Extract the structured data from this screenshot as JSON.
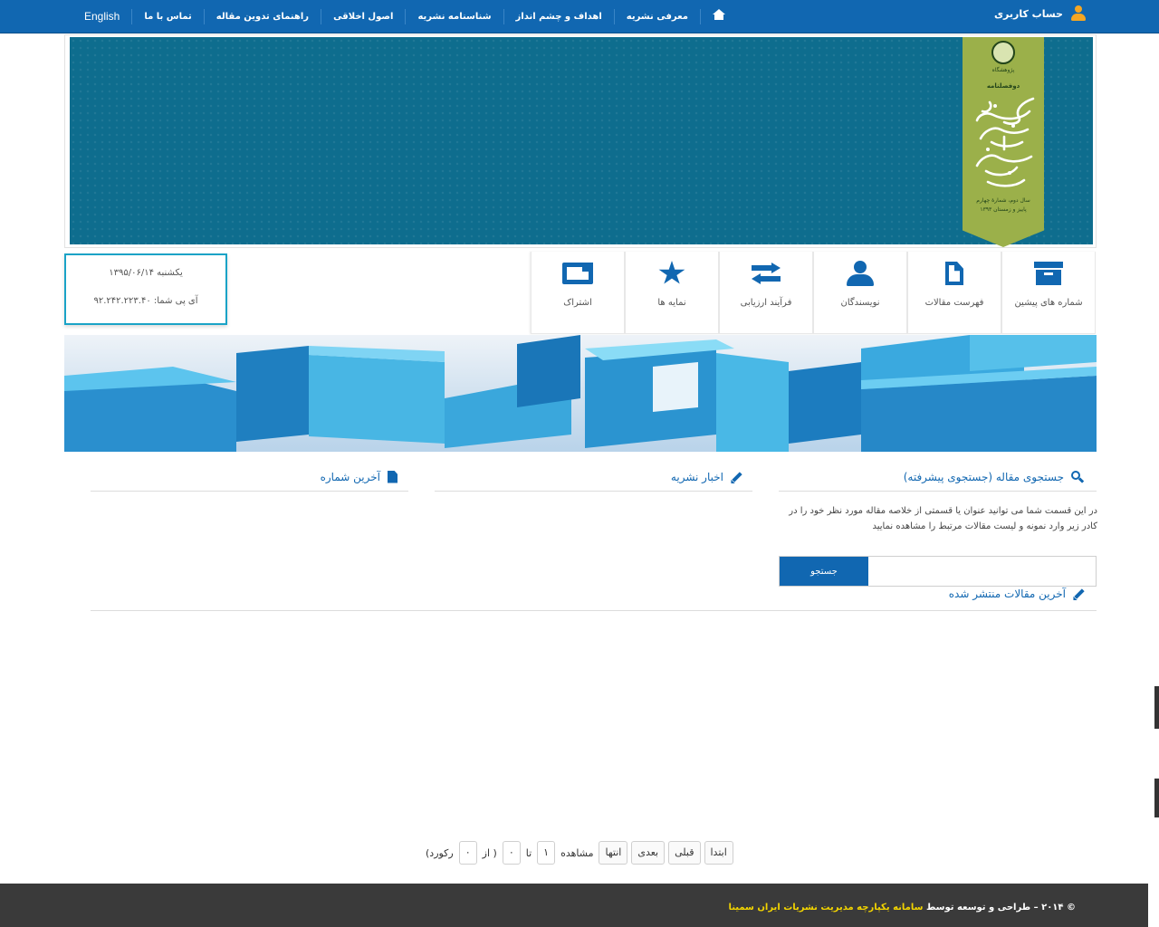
{
  "topnav": {
    "user_label": "حساب کاربری",
    "menu": [
      {
        "label": "معرفی نشریه"
      },
      {
        "label": "اهداف و چشم انداز"
      },
      {
        "label": "شناسنامه نشریه"
      },
      {
        "label": "اصول اخلاقی"
      },
      {
        "label": "راهنمای تدوین مقاله"
      },
      {
        "label": "تماس با ما"
      }
    ],
    "english": "English"
  },
  "header": {
    "bookmark_small": "پژوهشگاه",
    "bookmark_kind": "دوفصلنامه",
    "bookmark_issue_1": "سال دوم، شمارۀ چهارم",
    "bookmark_issue_2": "پاییز و زمستان ۱۳۹۳"
  },
  "datebox": {
    "date": "یکشنبه ۱۳۹۵/۰۶/۱۴",
    "ip": "آی پی شما: ۹۲.۲۴۲.۲۲۳.۴۰"
  },
  "tiles": [
    {
      "label": "شماره های پیشین",
      "icon": "archive-icon"
    },
    {
      "label": "فهرست مقالات",
      "icon": "file-icon"
    },
    {
      "label": "نویسندگان",
      "icon": "person-icon"
    },
    {
      "label": "فرآیند ارزیابی",
      "icon": "exchange-icon"
    },
    {
      "label": "نمایه ها",
      "icon": "star-icon"
    },
    {
      "label": "اشتراک",
      "icon": "card-icon"
    }
  ],
  "sections": {
    "search_title": "جستجوی مقاله (جستجوی پیشرفته)",
    "news_title": "اخبار نشریه",
    "last_issue_title": "آخرین شماره",
    "search_desc": "در این قسمت شما می توانید عنوان یا قسمتی از خلاصه مقاله مورد نظر خود را در کادر زیر وارد نمونه و لیست مقالات مرتبط را مشاهده نمایید",
    "search_button": "جستجو",
    "search_value": "",
    "latest_title": "آخرین مقالات منتشر شده"
  },
  "pager": {
    "first": "ابتدا",
    "prev": "قبلی",
    "next": "بعدی",
    "last": "انتها",
    "view": "مشاهده",
    "from_value": "۱",
    "to": "تا",
    "to_value": "۰",
    "of": "( از",
    "total": "۰",
    "records": "رکورد)"
  },
  "footer": {
    "prefix": "© ۲۰۱۴ – طراحی و توسعه توسط",
    "highlight": "سامانه یکپارچه مدیریت نشریات ایران سمینا"
  },
  "colors": {
    "primary": "#1167b1",
    "accent": "#f5a623",
    "footer": "#3a3a3a",
    "footer_highlight": "#f2d400"
  }
}
